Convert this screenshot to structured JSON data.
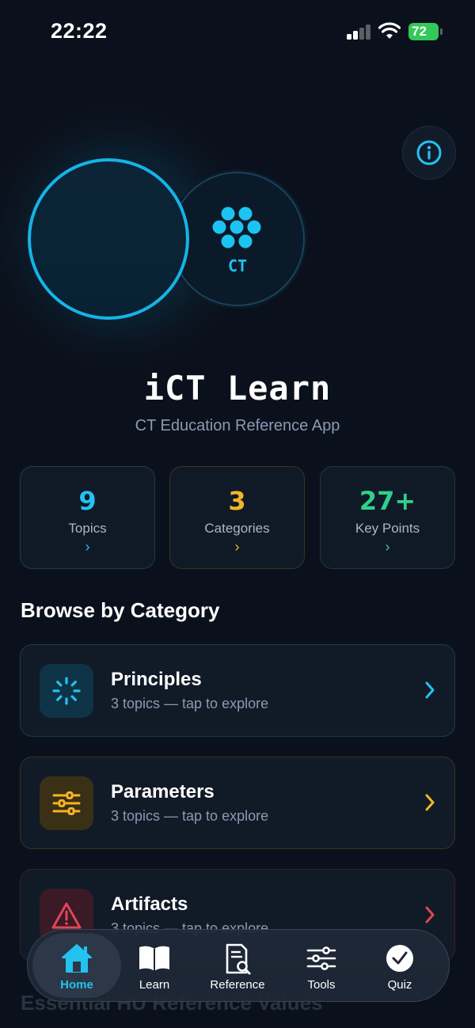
{
  "status_bar": {
    "time": "22:22",
    "battery": "72"
  },
  "hero": {
    "logo_text": "CT",
    "title": "iCT Learn",
    "subtitle": "CT Education Reference App"
  },
  "stats": [
    {
      "value": "9",
      "label": "Topics",
      "color": "#22c3f0"
    },
    {
      "value": "3",
      "label": "Categories",
      "color": "#f5b524"
    },
    {
      "value": "27+",
      "label": "Key Points",
      "color": "#2fd08d"
    }
  ],
  "section_title": "Browse by Category",
  "categories": [
    {
      "name": "Principles",
      "subtitle": "3 topics — tap to explore",
      "accent": "#22c3f0",
      "icon": "loader-icon"
    },
    {
      "name": "Parameters",
      "subtitle": "3 topics — tap to explore",
      "accent": "#f5b524",
      "icon": "sliders-icon"
    },
    {
      "name": "Artifacts",
      "subtitle": "3 topics — tap to explore",
      "accent": "#e0455a",
      "icon": "warning-icon"
    }
  ],
  "next_section_title": "Essential HU Reference Values",
  "tabs": [
    {
      "label": "Home",
      "icon": "home-icon",
      "active": true
    },
    {
      "label": "Learn",
      "icon": "book-icon"
    },
    {
      "label": "Reference",
      "icon": "document-search-icon"
    },
    {
      "label": "Tools",
      "icon": "sliders-icon"
    },
    {
      "label": "Quiz",
      "icon": "checkmark-circle-icon"
    }
  ]
}
